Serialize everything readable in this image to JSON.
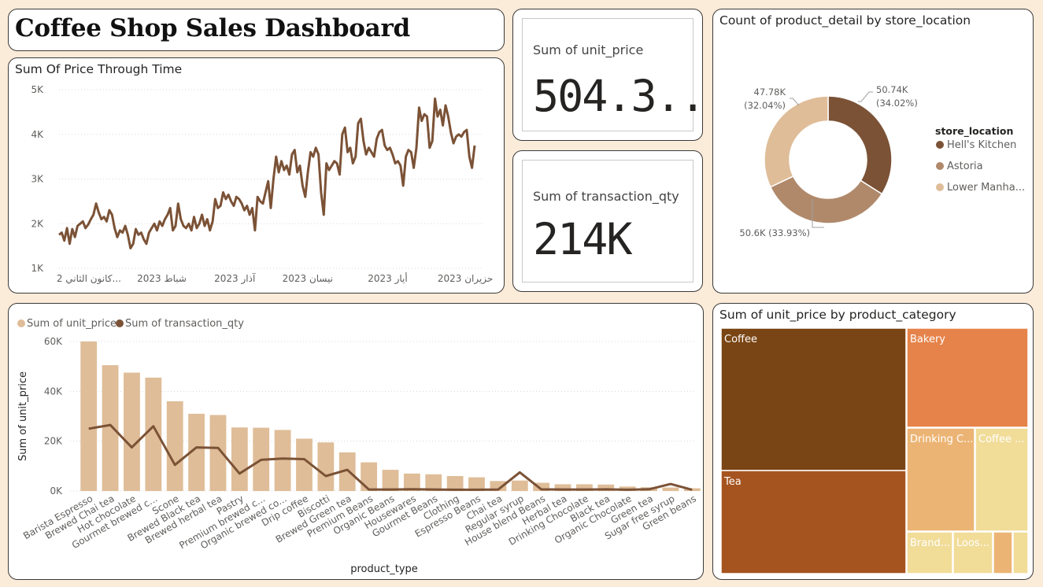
{
  "dashboard": {
    "title": "Coffee Shop Sales Dashboard"
  },
  "colors": {
    "background": "#fbebd9",
    "dark_brown": "#7b5236",
    "mid_brown": "#b0896b",
    "light_brown": "#dfbd98",
    "coffee_tile": "#7a4514",
    "tea_tile": "#a6541f",
    "bakery_tile": "#e6834a",
    "drinking_tile": "#ecb474",
    "coffee_beans_tile": "#f1dc98"
  },
  "kpi": {
    "unit_price": {
      "label": "Sum of unit_price",
      "value": "504.3..."
    },
    "transaction_qty": {
      "label": "Sum of transaction_qty",
      "value": "214K"
    }
  },
  "line_chart": {
    "title": "Sum Of Price Through Time",
    "chart_data": {
      "type": "line",
      "title": "Sum Of Price Through Time",
      "y_ticks": [
        "1K",
        "2K",
        "3K",
        "4K",
        "5K"
      ],
      "ylim": [
        1000,
        5000
      ],
      "x_ticks": [
        "2 كانون الثاني...",
        "2023 شباط",
        "2023 آذار",
        "2023 نيسان",
        "2023 أيار",
        "2023 حزيران"
      ],
      "x_start": "2023-01-01",
      "x_end": "2023-06-30",
      "values": [
        1750,
        1800,
        1620,
        1900,
        1550,
        1880,
        1700,
        1950,
        2000,
        2050,
        1900,
        1980,
        2100,
        2200,
        2450,
        2250,
        2100,
        2150,
        2050,
        2300,
        2200,
        1900,
        1700,
        1850,
        1800,
        1950,
        1750,
        1450,
        1550,
        1880,
        1750,
        1800,
        1650,
        1550,
        1800,
        1900,
        2000,
        1850,
        2050,
        1950,
        2100,
        2200,
        2350,
        1850,
        1950,
        2450,
        2100,
        1950,
        1900,
        2000,
        1850,
        2150,
        1900,
        2000,
        2200,
        1950,
        2100,
        1850,
        2050,
        2550,
        2350,
        2400,
        2700,
        2550,
        2650,
        2500,
        2400,
        2600,
        2550,
        2450,
        2300,
        2400,
        2200,
        2350,
        1850,
        2600,
        2500,
        2450,
        2700,
        2950,
        2350,
        3000,
        3500,
        3150,
        3400,
        3200,
        3300,
        3100,
        3550,
        3650,
        3150,
        3300,
        2850,
        2600,
        3150,
        3600,
        3500,
        3700,
        3550,
        2700,
        2200,
        3350,
        3200,
        3300,
        3400,
        3350,
        3100,
        4000,
        4150,
        3600,
        3700,
        3350,
        3500,
        4250,
        4350,
        3850,
        3550,
        3700,
        3600,
        3500,
        3900,
        4050,
        4100,
        3750,
        3650,
        3700,
        3550,
        3350,
        3400,
        3300,
        2850,
        3500,
        3650,
        3600,
        3250,
        3700,
        4600,
        4300,
        4450,
        4400,
        3700,
        3850,
        4800,
        4400,
        4550,
        4200,
        4650,
        4400,
        4050,
        3800,
        3950,
        4000,
        3950,
        4050,
        4100,
        3500,
        3250,
        3750
      ]
    }
  },
  "donut": {
    "title": "Count of product_detail by store_location",
    "legend_title": "store_location",
    "chart_data": {
      "type": "pie",
      "title": "Count of product_detail by store_location",
      "legend_title": "store_location",
      "slices": [
        {
          "name": "Hell's Kitchen",
          "value": 50740,
          "label_value": "50.74K",
          "label_pct": "(34.02%)",
          "color": "#7b5236"
        },
        {
          "name": "Astoria",
          "value": 50600,
          "label_value": "50.6K",
          "label_pct": "(33.93%)",
          "color": "#b0896b"
        },
        {
          "name": "Lower Manha...",
          "value": 47780,
          "label_value": "47.78K",
          "label_pct": "(32.04%)",
          "color": "#dfbd98"
        }
      ]
    }
  },
  "combo": {
    "chart_data": {
      "type": "bar",
      "xlabel": "product_type",
      "ylabel": "Sum of unit_price",
      "y_ticks": [
        "0K",
        "20K",
        "40K",
        "60K"
      ],
      "ylim": [
        0,
        60000
      ],
      "series": [
        {
          "name": "Sum of unit_price",
          "type": "bar",
          "color": "#dfbd98",
          "values": [
            60000,
            50500,
            47500,
            45500,
            36000,
            31000,
            30500,
            25500,
            25400,
            24500,
            21000,
            19500,
            15500,
            11500,
            8500,
            7000,
            6700,
            6000,
            5500,
            4000,
            4200,
            3300,
            2700,
            2700,
            2600,
            1800,
            1500,
            1400,
            1100
          ]
        },
        {
          "name": "Sum of transaction_qty",
          "type": "line",
          "color": "#7b5236",
          "values": [
            25000,
            26500,
            17500,
            26000,
            10500,
            17500,
            17300,
            7000,
            12500,
            13000,
            12800,
            6000,
            8500,
            600,
            600,
            700,
            600,
            500,
            500,
            600,
            7500,
            650,
            600,
            600,
            650,
            500,
            700,
            2800,
            500
          ]
        }
      ],
      "categories": [
        "Barista Espresso",
        "Brewed Chai tea",
        "Hot chocolate",
        "Gourmet brewed c...",
        "Scone",
        "Brewed Black tea",
        "Brewed herbal tea",
        "Pastry",
        "Premium brewed c...",
        "Organic brewed co...",
        "Drip coffee",
        "Biscotti",
        "Brewed Green tea",
        "Premium Beans",
        "Organic Beans",
        "Housewares",
        "Gourmet Beans",
        "Clothing",
        "Espresso Beans",
        "Chai tea",
        "Regular syrup",
        "House blend Beans",
        "Herbal tea",
        "Drinking Chocolate",
        "Black tea",
        "Organic Chocolate",
        "Green tea",
        "Sugar free syrup",
        "Green beans"
      ]
    }
  },
  "treemap": {
    "title": "Sum of unit_price by product_category",
    "chart_data": {
      "type": "treemap",
      "title": "Sum of unit_price by product_category",
      "items": [
        {
          "label": "Coffee",
          "color": "#7a4514"
        },
        {
          "label": "Tea",
          "color": "#a6541f"
        },
        {
          "label": "Bakery",
          "color": "#e6834a"
        },
        {
          "label": "Drinking C...",
          "color": "#ecb474"
        },
        {
          "label": "Coffee ...",
          "color": "#f1dc98"
        },
        {
          "label": "Brand...",
          "color": "#f1dc98"
        },
        {
          "label": "Loos...",
          "color": "#f1dc98"
        },
        {
          "label": "",
          "color": "#ecb474"
        },
        {
          "label": "",
          "color": "#f1dc98"
        }
      ]
    }
  }
}
